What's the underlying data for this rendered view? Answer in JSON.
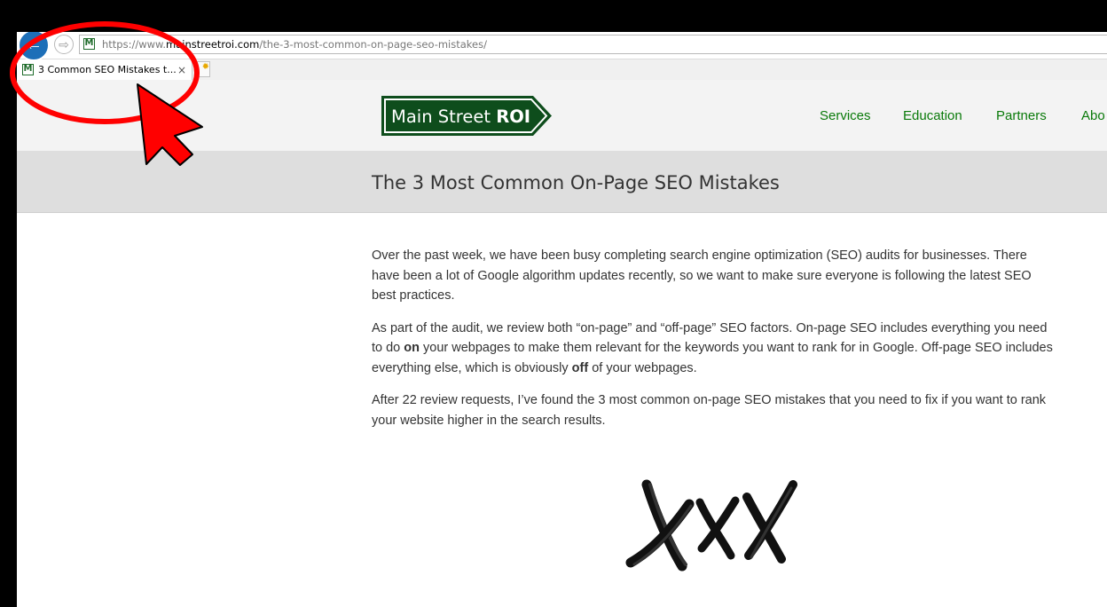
{
  "browser": {
    "url_scheme": "https://www.",
    "url_domain": "mainstreetroi.com",
    "url_path": "/the-3-most-common-on-page-seo-mistakes/",
    "tab_title": "3 Common SEO Mistakes t...",
    "tab_close": "×",
    "favicon_letter": "M",
    "back_icon": "back-arrow-icon",
    "forward_icon": "forward-arrow-icon"
  },
  "site": {
    "logo_regular": "Main Street ",
    "logo_bold": "ROI",
    "brand_color": "#0e4d1c",
    "nav": [
      "Services",
      "Education",
      "Partners",
      "Abo"
    ],
    "nav_color": "#0a7a0a"
  },
  "page": {
    "title": "The 3 Most Common On-Page SEO Mistakes",
    "p1": "Over the past week, we have been busy completing search engine optimization (SEO) audits for businesses. There have been a lot of Google algorithm updates recently, so we want to make sure everyone is following the latest SEO best practices.",
    "p2": {
      "a": "As part of the audit, we review both “on-page” and “off-page” SEO factors.  On-page SEO includes everything you need to do ",
      "b": "on",
      "c": " your webpages to make them relevant for the keywords you want to rank for in Google.  Off-page SEO includes everything else, which is obviously ",
      "d": "off",
      "e": " of your webpages."
    },
    "p3": "After 22 review requests, I’ve found the 3 most common on-page SEO mistakes that you need to fix if you want to rank your website higher in the search results.",
    "image": "xxx-brush-marks-image"
  },
  "annotation": {
    "color": "#ff0000",
    "shapes": [
      "red-circle-highlight",
      "red-arrow-pointer"
    ]
  }
}
